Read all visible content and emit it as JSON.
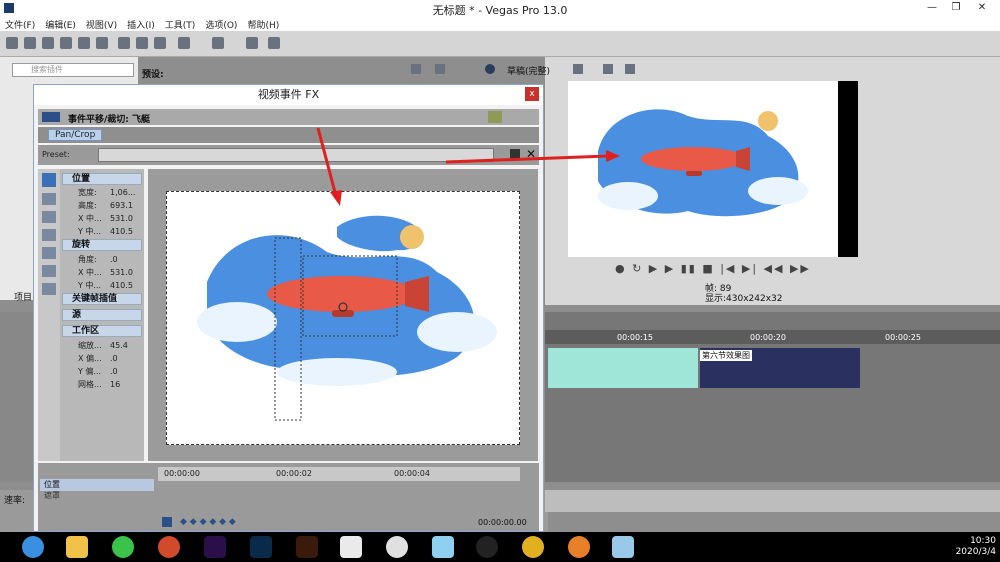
{
  "app": {
    "title": "无标题 * - Vegas Pro 13.0"
  },
  "menu": [
    "文件(F)",
    "编辑(E)",
    "视图(V)",
    "插入(I)",
    "工具(T)",
    "选项(O)",
    "帮助(H)"
  ],
  "left_panel": {
    "search_placeholder": "搜索插件",
    "preset_label": "预设:",
    "project_label": "项目"
  },
  "preview": {
    "quality": "草稿(完整)",
    "frame_label": "帧:",
    "frame_value": "89",
    "display_label": "显示:",
    "display_value": "430x242x32"
  },
  "timeline": {
    "ticks": [
      "00:00:15",
      "00:00:20",
      "00:00:25"
    ],
    "clip_label": "第六节效果图",
    "rate_label": "速率:"
  },
  "fx_dialog": {
    "title": "视频事件 FX",
    "chain_label": "事件平移/裁切: 飞艇",
    "tab": "Pan/Crop",
    "preset_label": "Preset:",
    "close": "x",
    "sections": {
      "position": "位置",
      "rotation": "旋转",
      "keyframe_interp": "关键帧插值",
      "source": "源",
      "workspace": "工作区"
    },
    "props_position": [
      {
        "k": "宽度:",
        "v": "1,06..."
      },
      {
        "k": "高度:",
        "v": "693.1"
      },
      {
        "k": "X 中...",
        "v": "531.0"
      },
      {
        "k": "Y 中...",
        "v": "410.5"
      }
    ],
    "props_rotation": [
      {
        "k": "角度:",
        "v": ".0"
      },
      {
        "k": "X 中...",
        "v": "531.0"
      },
      {
        "k": "Y 中...",
        "v": "410.5"
      }
    ],
    "props_workspace": [
      {
        "k": "缩放...",
        "v": "45.4"
      },
      {
        "k": "X 偏...",
        "v": ".0"
      },
      {
        "k": "Y 偏...",
        "v": ".0"
      },
      {
        "k": "网格...",
        "v": "16"
      }
    ],
    "keyframe_track": "位置",
    "mask_track": "遮罩",
    "timeline_ticks": [
      "00:00:00",
      "00:00:02",
      "00:00:04"
    ],
    "timecode": "00:00:00.00"
  },
  "taskbar": {
    "time": "10:30",
    "date": "2020/3/4"
  },
  "colors": {
    "accent": "#3b6fb6",
    "arrow": "#e0201e",
    "airship": "#e85a47",
    "sky": "#4a8fe0"
  }
}
